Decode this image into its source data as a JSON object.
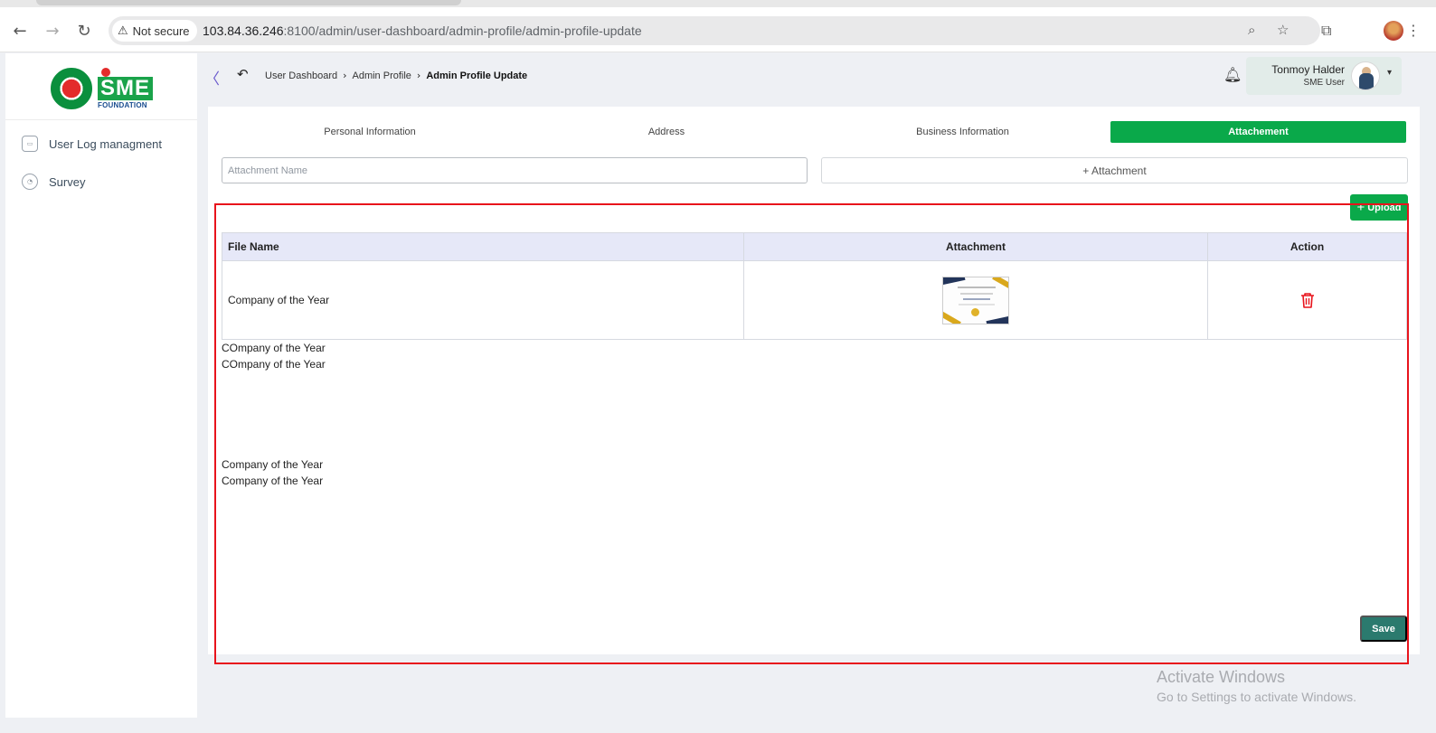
{
  "browser": {
    "security_label": "Not secure",
    "url_host": "103.84.36.246",
    "url_rest": ":8100/admin/user-dashboard/admin-profile/admin-profile-update"
  },
  "sidebar": {
    "logo_text": "SME",
    "logo_subtext": "FOUNDATION",
    "items": [
      {
        "label": "User Log managment",
        "icon": "log-icon"
      },
      {
        "label": "Survey",
        "icon": "pie-chart-icon"
      }
    ]
  },
  "header": {
    "breadcrumb": [
      "User Dashboard",
      "Admin Profile",
      "Admin Profile Update"
    ],
    "user_name": "Tonmoy Halder",
    "user_role": "SME User"
  },
  "tabs": [
    {
      "label": "Personal Information",
      "active": false
    },
    {
      "label": "Address",
      "active": false
    },
    {
      "label": "Business Information",
      "active": false
    },
    {
      "label": "Attachement",
      "active": true
    }
  ],
  "form": {
    "attachment_name_placeholder": "Attachment Name",
    "attachment_button": "+ Attachment",
    "upload_button": "Upload",
    "save_button": "Save"
  },
  "table": {
    "columns": [
      "File Name",
      "Attachment",
      "Action"
    ],
    "rows": [
      {
        "file_name": "Company of the Year"
      }
    ]
  },
  "broken_items": [
    {
      "caption": "COmpany of the Year",
      "alt": "COmpany of the Year"
    },
    {
      "caption": "Company of the Year",
      "alt": "Company of the Year"
    }
  ],
  "watermark": {
    "line1": "Activate Windows",
    "line2": "Go to Settings to activate Windows."
  },
  "colors": {
    "primary_green": "#0aa94a",
    "save_teal": "#2b7a6e",
    "highlight_red": "#e8141c",
    "table_header": "#e6e8f8"
  }
}
